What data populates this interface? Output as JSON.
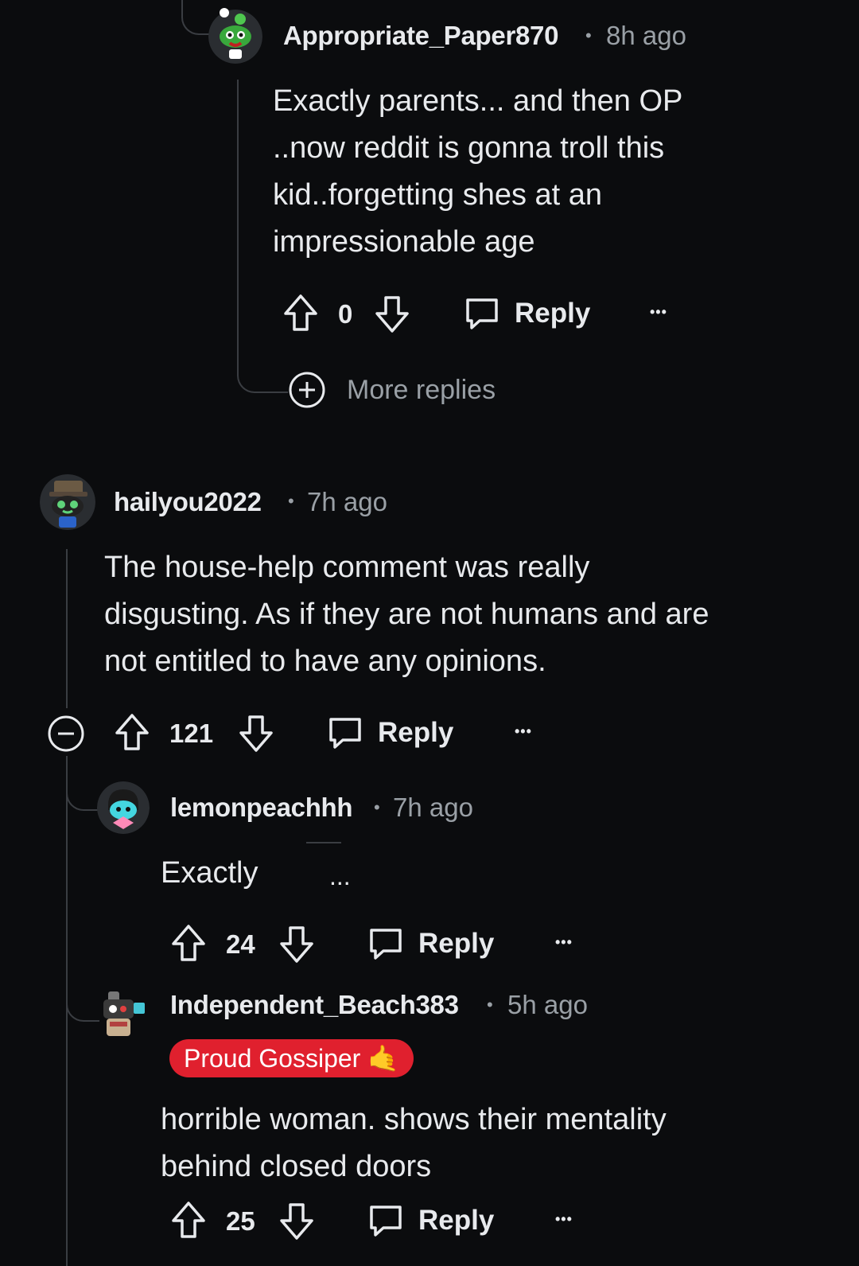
{
  "comments": [
    {
      "username": "Appropriate_Paper870",
      "separator": "•",
      "time": "8h ago",
      "body_lines": [
        "Exactly parents... and then OP",
        "..now reddit is gonna troll this",
        "kid..forgetting shes at an",
        "impressionable age"
      ],
      "votes": "0",
      "reply_label": "Reply",
      "more_label": "•••",
      "avatar": "green-snoo-avatar-icon"
    },
    {
      "username": "hailyou2022",
      "separator": "•",
      "time": "7h ago",
      "body_lines": [
        "The house-help comment was really",
        "disgusting. As if they are not humans and are",
        "not entitled to have any opinions."
      ],
      "votes": "121",
      "reply_label": "Reply",
      "more_label": "•••",
      "avatar": "hat-robot-snoo-avatar-icon"
    },
    {
      "username": "lemonpeachhh",
      "separator": "•",
      "time": "7h ago",
      "body_lines": [
        "Exactly",
        "..."
      ],
      "votes": "24",
      "reply_label": "Reply",
      "more_label": "•••",
      "avatar": "cyan-snoo-avatar-icon"
    },
    {
      "username": "Independent_Beach383",
      "separator": "•",
      "time": "5h ago",
      "flair": "Proud Gossiper 🤙",
      "body_lines": [
        "horrible woman. shows their mentality",
        "behind closed doors"
      ],
      "votes": "25",
      "reply_label": "Reply",
      "more_label": "•••",
      "avatar": "camera-snoo-avatar-icon"
    }
  ],
  "more_replies_label": "More replies",
  "colors": {
    "background": "#0b0c0e",
    "text": "#e8eaed",
    "muted": "#9aa0a6",
    "thread_line": "#3a3d42",
    "flair_bg": "#e0202e"
  }
}
